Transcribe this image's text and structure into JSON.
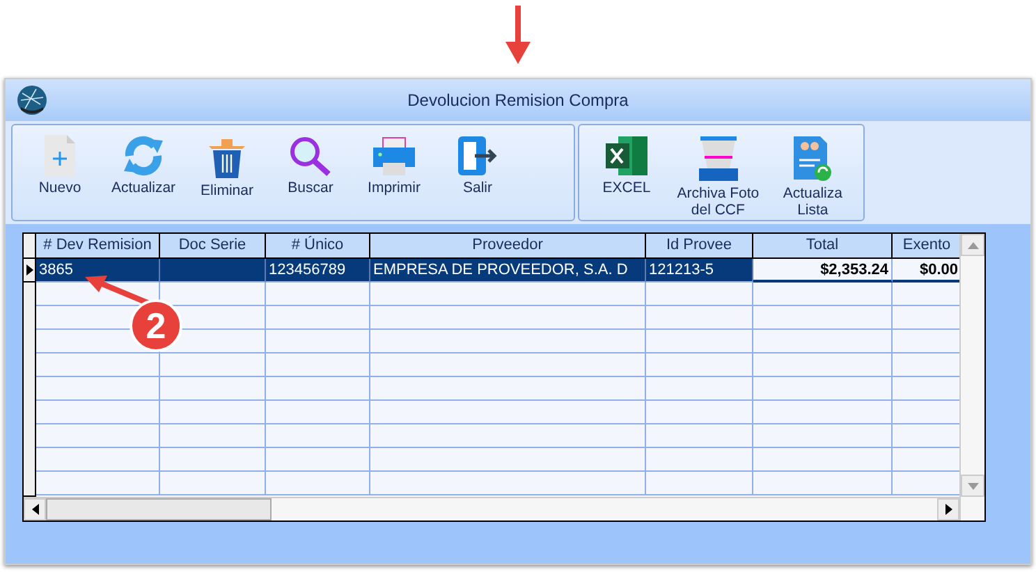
{
  "window": {
    "title": "Devolucion Remision Compra"
  },
  "toolbar": {
    "groups": [
      [
        {
          "label": "Nuevo",
          "kind": "new"
        },
        {
          "label": "Actualizar",
          "kind": "refresh"
        },
        {
          "label": "Eliminar",
          "kind": "trash"
        },
        {
          "label": "Buscar",
          "kind": "search"
        },
        {
          "label": "Imprimir",
          "kind": "print"
        },
        {
          "label": "Salir",
          "kind": "exit"
        }
      ],
      [
        {
          "label": "EXCEL",
          "kind": "excel"
        },
        {
          "label": "Archiva Foto del CCF",
          "kind": "scanner"
        },
        {
          "label": "Actualiza Lista",
          "kind": "list"
        }
      ]
    ]
  },
  "table": {
    "columns": [
      {
        "label": "# Dev Remision",
        "kind": "text"
      },
      {
        "label": "Doc Serie",
        "kind": "text"
      },
      {
        "label": "# Único",
        "kind": "text"
      },
      {
        "label": "Proveedor",
        "kind": "text"
      },
      {
        "label": "Id Provee",
        "kind": "text"
      },
      {
        "label": "Total",
        "kind": "money"
      },
      {
        "label": "Exento",
        "kind": "money"
      }
    ],
    "rows": [
      {
        "selected": true,
        "cells": [
          "3865",
          "",
          "123456789",
          "EMPRESA DE PROVEEDOR, S.A. D",
          "121213-5",
          "$2,353.24",
          "$0.00"
        ]
      }
    ]
  },
  "annotations": [
    {
      "kind": "arrow-down"
    },
    {
      "kind": "badge",
      "label": "2"
    }
  ]
}
